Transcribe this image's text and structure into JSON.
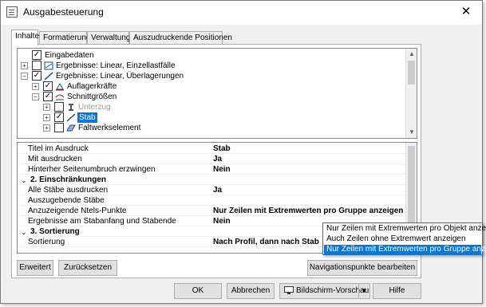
{
  "window": {
    "title": "Ausgabesteuerung",
    "close_glyph": "✕"
  },
  "tabs": [
    {
      "label": "Inhalte",
      "active": true
    },
    {
      "label": "Formatierung",
      "active": false
    },
    {
      "label": "Verwaltung",
      "active": false
    },
    {
      "label": "Auszudruckende Positionen",
      "active": false
    }
  ],
  "tree": {
    "items": [
      {
        "label": "Eingabedaten",
        "checked": true,
        "expander": "",
        "state": "normal"
      },
      {
        "label": "Ergebnisse: Linear, Einzellastfälle",
        "checked": false,
        "expander": "+",
        "state": "normal"
      },
      {
        "label": "Ergebnisse: Linear, Überlagerungen",
        "checked": true,
        "expander": "−",
        "state": "normal"
      },
      {
        "label": "Auflagerkräfte",
        "checked": true,
        "expander": "+",
        "state": "normal"
      },
      {
        "label": "Schnittgrößen",
        "checked": true,
        "expander": "−",
        "state": "normal"
      },
      {
        "label": "Unterzug",
        "checked": false,
        "expander": "+",
        "state": "dim"
      },
      {
        "label": "Stab",
        "checked": true,
        "expander": "+",
        "state": "selected"
      },
      {
        "label": "Faltwerkselement",
        "checked": false,
        "expander": "+",
        "state": "normal"
      }
    ]
  },
  "properties": {
    "rows": [
      {
        "name": "Titel im Ausdruck",
        "value": "Stab",
        "header": false
      },
      {
        "name": "Mit ausdrucken",
        "value": "Ja",
        "header": false
      },
      {
        "name": "Hinterher Seitenumbruch erzwingen",
        "value": "Nein",
        "header": false
      },
      {
        "name": "2. Einschränkungen",
        "value": "",
        "header": true
      },
      {
        "name": "Alle Stäbe ausdrucken",
        "value": "Ja",
        "header": false
      },
      {
        "name": "Auszugebende Stäbe",
        "value": "",
        "header": false
      },
      {
        "name": "Anzuzeigende Ntels-Punkte",
        "value": "Nur Zeilen mit Extremwerten pro Gruppe anzeigen",
        "header": false
      },
      {
        "name": "Ergebnisse am Stabanfang und Stabende",
        "value": "Nein",
        "header": false
      },
      {
        "name": "3. Sortierung",
        "value": "",
        "header": true
      },
      {
        "name": "Sortierung",
        "value": "Nach Profil, dann nach Stab",
        "header": false
      }
    ],
    "chevron_glyph": "⌄"
  },
  "dropdown": {
    "options": [
      {
        "label": "Nur Zeilen mit Extremwerten pro Objekt anzeigen",
        "selected": false
      },
      {
        "label": "Auch Zeilen ohne Extremwert anzeigen",
        "selected": false
      },
      {
        "label": "Nur Zeilen mit Extremwerten pro Gruppe anzeigen",
        "selected": true
      }
    ]
  },
  "panel_buttons": {
    "erweitert": "Erweitert",
    "zuruecksetzen": "Zurücksetzen",
    "navigationspunkte": "Navigationspunkte bearbeiten"
  },
  "footer_buttons": {
    "ok": "OK",
    "abbrechen": "Abbrechen",
    "bildschirm_vorschau": "Bildschirm-Vorschau",
    "hilfe": "Hilfe"
  },
  "colors": {
    "selection": "#0078d7",
    "background": "#f0f0f0",
    "border": "#adadad"
  },
  "icons": [
    "window-app-icon",
    "close-icon",
    "results-icon",
    "diagonal-line-icon",
    "member-icon",
    "surface-element-icon",
    "monitor-icon",
    "dropdown-arrow-icon",
    "chevron-down-icon"
  ]
}
